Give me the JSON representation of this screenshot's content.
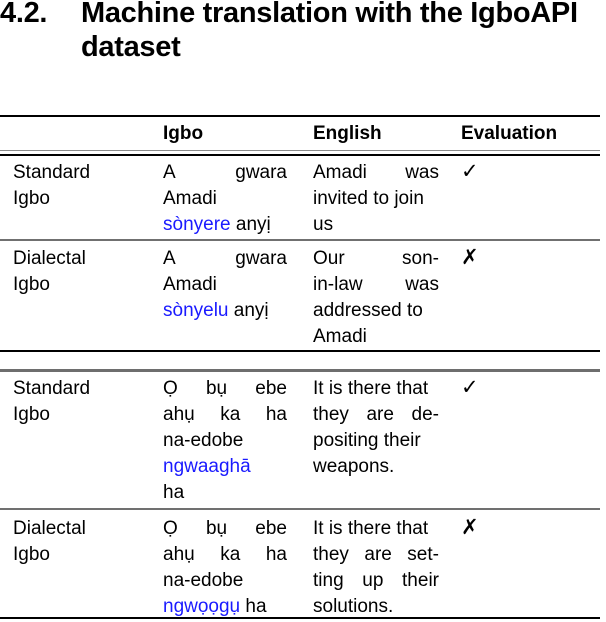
{
  "section": {
    "number": "4.2.",
    "title_line1": "Machine translation with the IgboAPI",
    "title_line2": "dataset"
  },
  "table": {
    "headers": [
      "",
      "Igbo",
      "English",
      "Evaluation"
    ],
    "groups": [
      {
        "rows": [
          {
            "variety_lines": [
              "Standard",
              "Igbo"
            ],
            "igbo_lines": [
              {
                "parts": [
                  {
                    "text": "A",
                    "highlight": false
                  },
                  {
                    "text": "gwara",
                    "highlight": false
                  }
                ],
                "justify": true
              },
              {
                "parts": [
                  {
                    "text": "Amadi",
                    "highlight": false
                  }
                ]
              },
              {
                "parts": [
                  {
                    "text": "sònyere",
                    "highlight": true
                  },
                  {
                    "text": " anyị",
                    "highlight": false
                  }
                ]
              }
            ],
            "english_lines": [
              {
                "parts": [
                  "Amadi",
                  "was"
                ],
                "justify": true
              },
              {
                "parts": [
                  "invited to join"
                ]
              },
              {
                "parts": [
                  "us"
                ]
              }
            ],
            "evaluation": "✓",
            "evaluation_icon": "check-icon"
          },
          {
            "variety_lines": [
              "Dialectal",
              "Igbo"
            ],
            "igbo_lines": [
              {
                "parts": [
                  {
                    "text": "A",
                    "highlight": false
                  },
                  {
                    "text": "gwara",
                    "highlight": false
                  }
                ],
                "justify": true
              },
              {
                "parts": [
                  {
                    "text": "Amadi",
                    "highlight": false
                  }
                ]
              },
              {
                "parts": [
                  {
                    "text": "sònyelu",
                    "highlight": true
                  },
                  {
                    "text": " anyị",
                    "highlight": false
                  }
                ]
              }
            ],
            "english_lines": [
              {
                "parts": [
                  "Our",
                  "son-"
                ],
                "justify": true
              },
              {
                "parts": [
                  "in-law",
                  "was"
                ],
                "justify": true
              },
              {
                "parts": [
                  "addressed to"
                ]
              },
              {
                "parts": [
                  "Amadi"
                ]
              }
            ],
            "evaluation": "✗",
            "evaluation_icon": "cross-icon"
          }
        ]
      },
      {
        "rows": [
          {
            "variety_lines": [
              "Standard",
              "Igbo"
            ],
            "igbo_lines": [
              {
                "parts": [
                  {
                    "text": "Ọ",
                    "highlight": false
                  },
                  {
                    "text": "bụ",
                    "highlight": false
                  },
                  {
                    "text": "ebe",
                    "highlight": false
                  }
                ],
                "justify": true
              },
              {
                "parts": [
                  {
                    "text": "ahụ",
                    "highlight": false
                  },
                  {
                    "text": "ka",
                    "highlight": false
                  },
                  {
                    "text": "ha",
                    "highlight": false
                  }
                ],
                "justify": true
              },
              {
                "parts": [
                  {
                    "text": "na-edobe",
                    "highlight": false
                  }
                ]
              },
              {
                "parts": [
                  {
                    "text": "ngwaaghā",
                    "highlight": true
                  }
                ]
              },
              {
                "parts": [
                  {
                    "text": "ha",
                    "highlight": false
                  }
                ]
              }
            ],
            "english_lines": [
              {
                "parts": [
                  "It is there that"
                ]
              },
              {
                "parts": [
                  "they",
                  "are",
                  "de-"
                ],
                "justify": true
              },
              {
                "parts": [
                  "positing their"
                ]
              },
              {
                "parts": [
                  "weapons."
                ]
              }
            ],
            "evaluation": "✓",
            "evaluation_icon": "check-icon"
          },
          {
            "variety_lines": [
              "Dialectal",
              "Igbo"
            ],
            "igbo_lines": [
              {
                "parts": [
                  {
                    "text": "Ọ",
                    "highlight": false
                  },
                  {
                    "text": "bụ",
                    "highlight": false
                  },
                  {
                    "text": "ebe",
                    "highlight": false
                  }
                ],
                "justify": true
              },
              {
                "parts": [
                  {
                    "text": "ahụ",
                    "highlight": false
                  },
                  {
                    "text": "ka",
                    "highlight": false
                  },
                  {
                    "text": "ha",
                    "highlight": false
                  }
                ],
                "justify": true
              },
              {
                "parts": [
                  {
                    "text": "na-edobe",
                    "highlight": false
                  }
                ]
              },
              {
                "parts": [
                  {
                    "text": "ngwọọgụ",
                    "highlight": true
                  },
                  {
                    "text": " ha",
                    "highlight": false
                  }
                ]
              }
            ],
            "english_lines": [
              {
                "parts": [
                  "It is there that"
                ]
              },
              {
                "parts": [
                  "they",
                  "are",
                  "set-"
                ],
                "justify": true
              },
              {
                "parts": [
                  "ting",
                  "up",
                  "their"
                ],
                "justify": true
              },
              {
                "parts": [
                  "solutions."
                ]
              }
            ],
            "evaluation": "✗",
            "evaluation_icon": "cross-icon"
          }
        ]
      }
    ]
  },
  "colors": {
    "highlight": "#1a1aff",
    "rule_black": "#000000",
    "rule_grey": "#707070"
  }
}
